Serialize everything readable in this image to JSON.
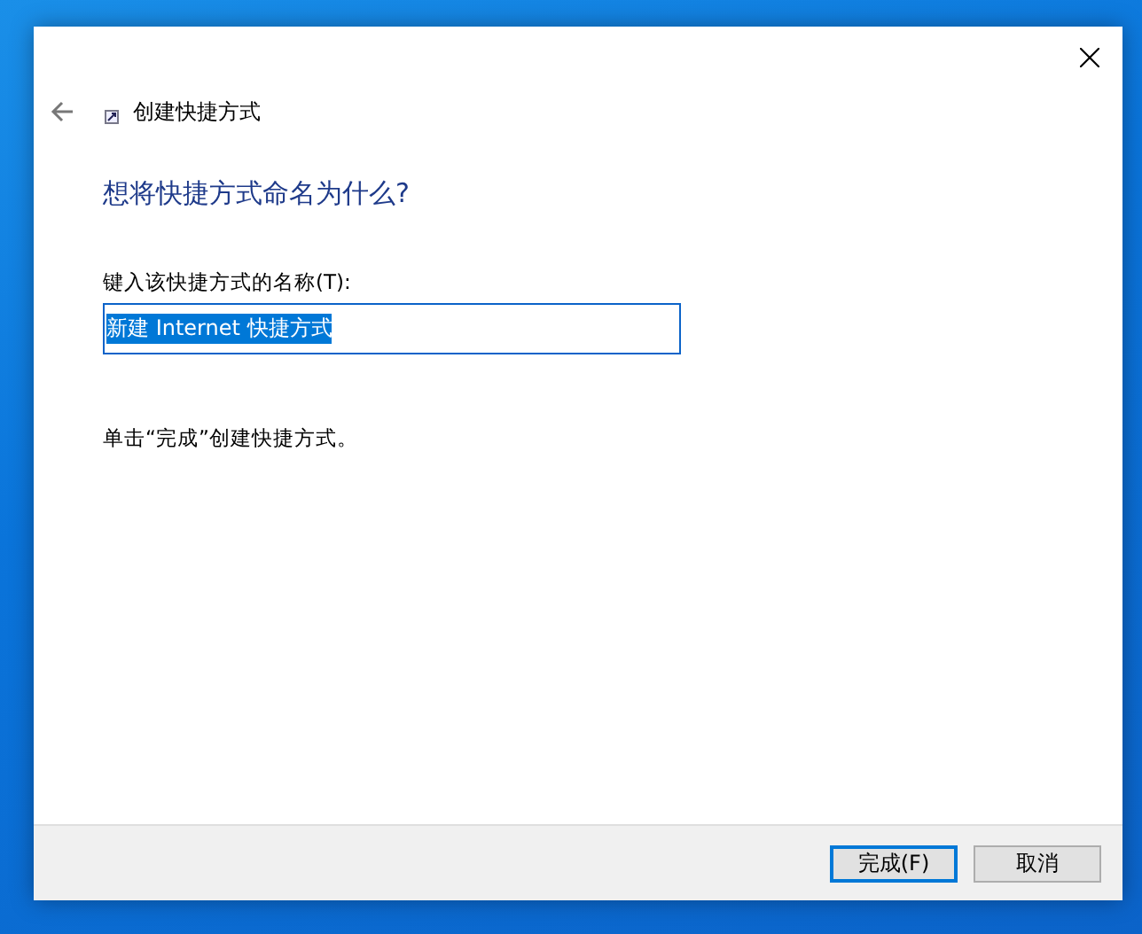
{
  "window": {
    "title": "创建快捷方式"
  },
  "heading": "想将快捷方式命名为什么?",
  "name_field": {
    "label": "键入该快捷方式的名称(T):",
    "value": "新建 Internet 快捷方式",
    "selected": true
  },
  "instruction": "单击“完成”创建快捷方式。",
  "buttons": [
    {
      "label": "完成(F)",
      "default": true
    },
    {
      "label": "取消",
      "default": false
    }
  ]
}
